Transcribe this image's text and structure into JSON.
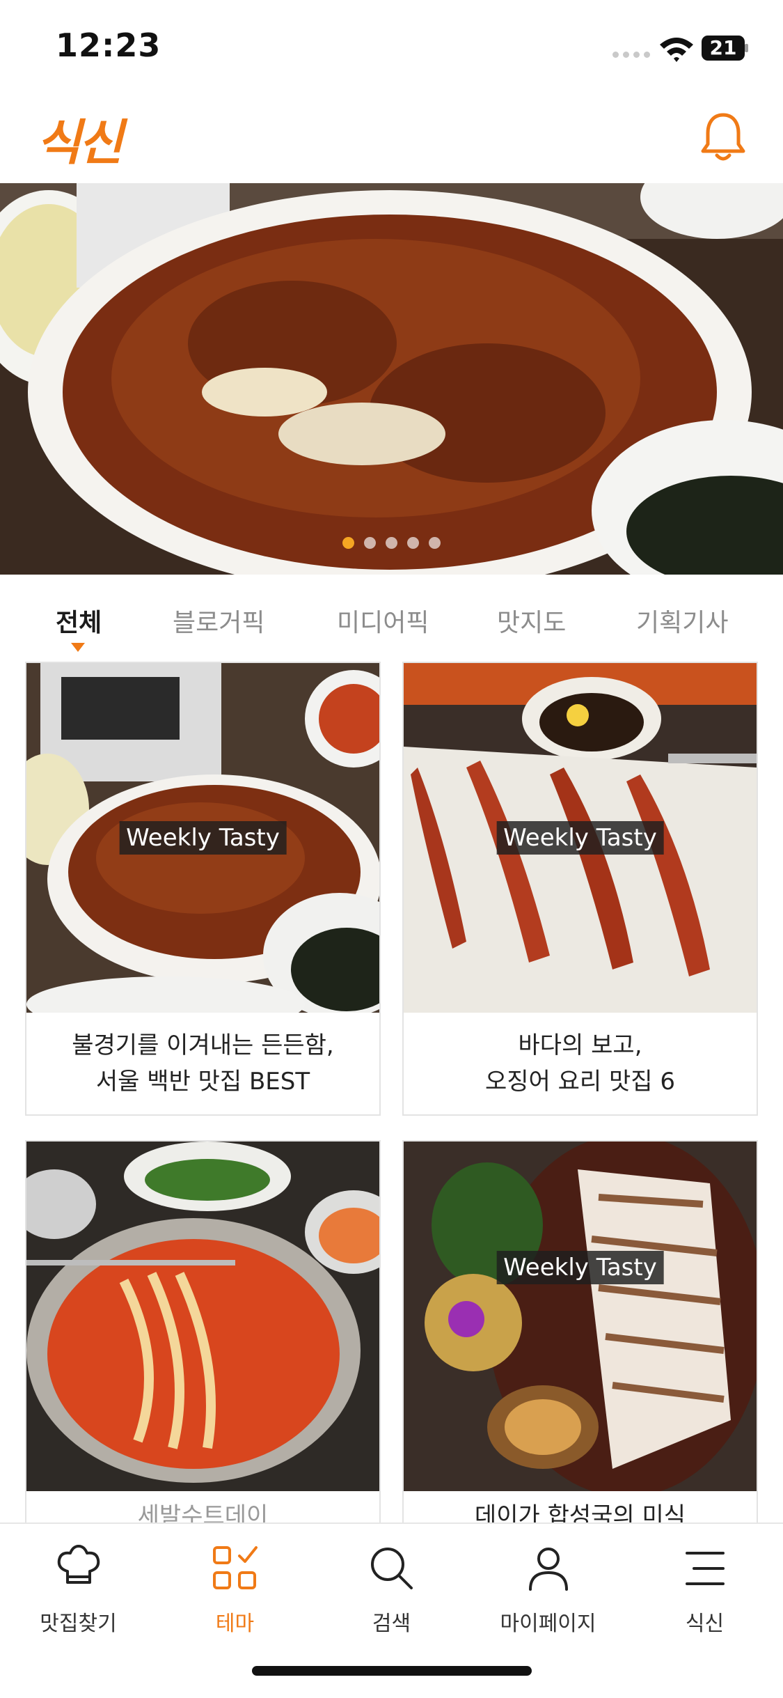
{
  "status": {
    "time": "12:23",
    "battery": "21"
  },
  "header": {
    "logo": "식신"
  },
  "banner": {
    "slide_count": 5,
    "active_slide": 1
  },
  "tabs": [
    {
      "label": "전체",
      "active": true
    },
    {
      "label": "블로거픽",
      "active": false
    },
    {
      "label": "미디어픽",
      "active": false
    },
    {
      "label": "맛지도",
      "active": false
    },
    {
      "label": "기획기사",
      "active": false
    }
  ],
  "cards": [
    {
      "badge": "Weekly Tasty",
      "line1": "불경기를 이겨내는 든든함,",
      "line2": "서울 백반 맛집 BEST"
    },
    {
      "badge": "Weekly Tasty",
      "line1": "바다의 보고,",
      "line2": "오징어 요리 맛집 6"
    },
    {
      "badge": "",
      "line1": "세발수트데이",
      "line2": ""
    },
    {
      "badge": "Weekly Tasty",
      "line1": "데이가 합성국의 미식",
      "line2": ""
    }
  ],
  "nav": [
    {
      "label": "맛집찾기",
      "icon": "chef-hat-icon",
      "active": false
    },
    {
      "label": "테마",
      "icon": "theme-grid-icon",
      "active": true
    },
    {
      "label": "검색",
      "icon": "search-icon",
      "active": false
    },
    {
      "label": "마이페이지",
      "icon": "person-icon",
      "active": false
    },
    {
      "label": "식신",
      "icon": "menu-icon",
      "active": false
    }
  ],
  "colors": {
    "accent": "#f07a16",
    "dot_active": "#f5a623"
  }
}
